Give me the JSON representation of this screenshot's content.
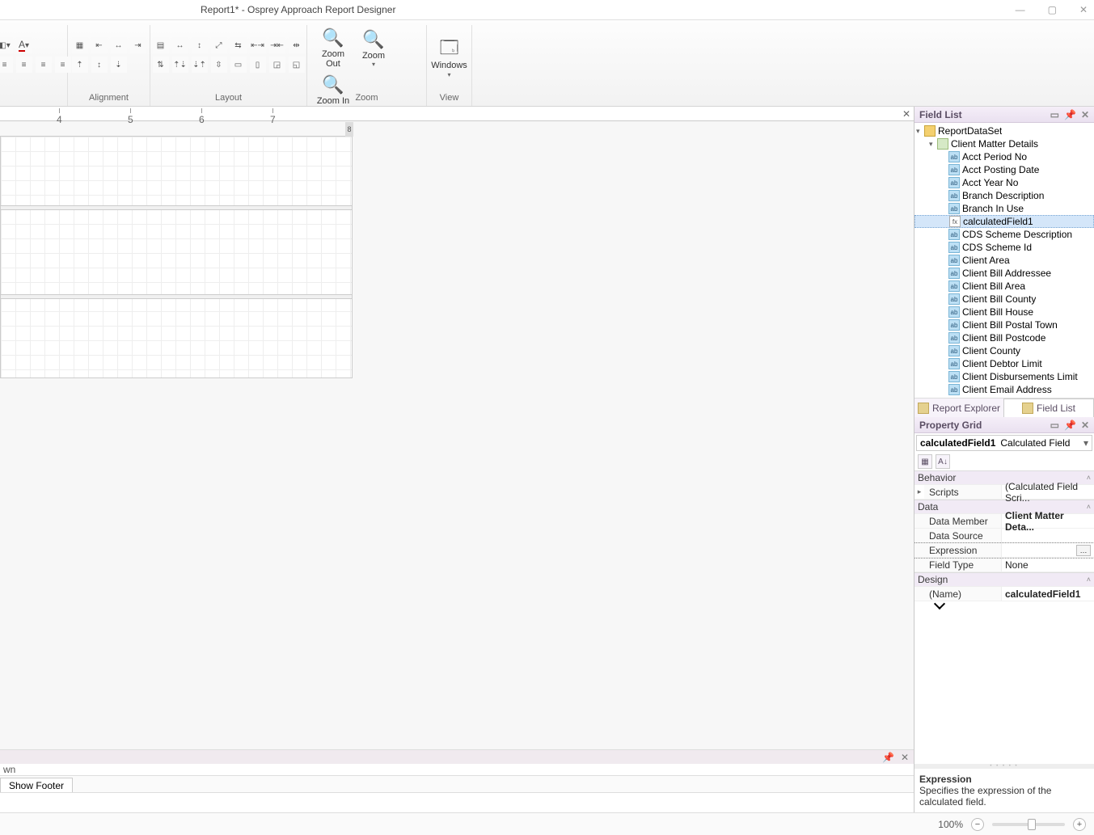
{
  "window": {
    "title": "Report1* - Osprey Approach Report Designer"
  },
  "ribbon": {
    "groups": {
      "font_unnamed": "",
      "alignment": "Alignment",
      "layout": "Layout",
      "zoom": "Zoom",
      "view": "View"
    },
    "zoom_out": "Zoom Out",
    "zoom": "Zoom",
    "zoom_in": "Zoom In",
    "windows": "Windows"
  },
  "ruler": {
    "marks": [
      "4",
      "5",
      "6",
      "7",
      "8"
    ]
  },
  "field_list": {
    "title": "Field List",
    "root": "ReportDataSet",
    "table": "Client Matter Details",
    "selected": "calculatedField1",
    "fields": [
      "Acct Period No",
      "Acct Posting Date",
      "Acct Year No",
      "Branch Description",
      "Branch In Use",
      "calculatedField1",
      "CDS Scheme Description",
      "CDS Scheme Id",
      "Client Area",
      "Client Bill Addressee",
      "Client Bill Area",
      "Client Bill County",
      "Client Bill House",
      "Client Bill Postal Town",
      "Client Bill Postcode",
      "Client County",
      "Client Debtor Limit",
      "Client Disbursements Limit",
      "Client Email Address"
    ],
    "tabs": {
      "report_explorer": "Report Explorer",
      "field_list": "Field List"
    }
  },
  "property_grid": {
    "title": "Property Grid",
    "selected_name": "calculatedField1",
    "selected_type": "Calculated Field",
    "categories": {
      "behavior": "Behavior",
      "data": "Data",
      "design": "Design"
    },
    "rows": {
      "scripts_k": "Scripts",
      "scripts_v": "(Calculated Field Scri...",
      "data_member_k": "Data Member",
      "data_member_v": "Client Matter Deta...",
      "data_source_k": "Data Source",
      "data_source_v": "",
      "expression_k": "Expression",
      "expression_v": "",
      "field_type_k": "Field Type",
      "field_type_v": "None",
      "name_k": "(Name)",
      "name_v": "calculatedField1"
    },
    "description": {
      "title": "Expression",
      "text": "Specifies the expression of the calculated field."
    }
  },
  "bottom": {
    "partial_text": "wn",
    "filter_tab": "Show Footer"
  },
  "status": {
    "zoom_pct": "100%"
  }
}
